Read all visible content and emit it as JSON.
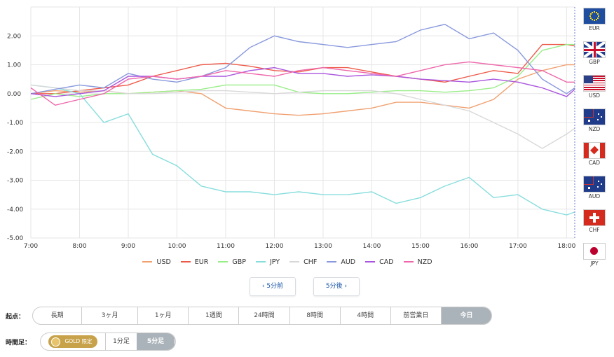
{
  "chart_data": {
    "type": "line",
    "x": [
      "7:00",
      "7:30",
      "8:00",
      "8:30",
      "9:00",
      "9:30",
      "10:00",
      "10:30",
      "11:00",
      "11:30",
      "12:00",
      "12:30",
      "13:00",
      "13:30",
      "14:00",
      "14:30",
      "15:00",
      "15:30",
      "16:00",
      "16:30",
      "17:00",
      "17:30",
      "18:00",
      "18:10"
    ],
    "x_ticks": [
      "7:00",
      "8:00",
      "9:00",
      "10:00",
      "11:00",
      "12:00",
      "13:00",
      "14:00",
      "15:00",
      "16:00",
      "17:00",
      "18:00"
    ],
    "y_ticks": [
      "2.00",
      "1.00",
      "0.00",
      "-1.00",
      "-2.00",
      "-3.00",
      "-4.00",
      "-5.00"
    ],
    "ylim": [
      -5,
      3
    ],
    "grid": true,
    "legend_position": "bottom",
    "series": [
      {
        "name": "USD",
        "color": "#f0a070",
        "values": [
          0,
          0.1,
          0.05,
          0.1,
          0,
          0.05,
          0.1,
          0,
          -0.5,
          -0.6,
          -0.7,
          -0.75,
          -0.7,
          -0.6,
          -0.5,
          -0.3,
          -0.3,
          -0.4,
          -0.5,
          -0.2,
          0.5,
          0.8,
          1.0,
          1.0
        ]
      },
      {
        "name": "EUR",
        "color": "#ee5a4a",
        "values": [
          0,
          0,
          0.1,
          0.2,
          0.3,
          0.6,
          0.8,
          1.0,
          1.05,
          0.95,
          0.8,
          0.75,
          0.9,
          0.9,
          0.75,
          0.6,
          0.5,
          0.4,
          0.6,
          0.8,
          0.7,
          1.7,
          1.7,
          1.65
        ]
      },
      {
        "name": "GBP",
        "color": "#99ee88",
        "values": [
          -0.2,
          0,
          -0.1,
          0,
          0,
          0.05,
          0.1,
          0.15,
          0.3,
          0.3,
          0.3,
          0.05,
          0,
          0,
          0.05,
          0.1,
          0.1,
          0.05,
          0.1,
          0.2,
          0.6,
          1.5,
          1.7,
          1.7
        ]
      },
      {
        "name": "JPY",
        "color": "#88dddd",
        "values": [
          0.3,
          0.2,
          0,
          -1.0,
          -0.7,
          -2.1,
          -2.5,
          -3.2,
          -3.4,
          -3.4,
          -3.5,
          -3.4,
          -3.5,
          -3.5,
          -3.4,
          -3.8,
          -3.6,
          -3.2,
          -2.9,
          -3.6,
          -3.5,
          -4.0,
          -4.2,
          -4.1
        ]
      },
      {
        "name": "CHF",
        "color": "#d8d8d8",
        "values": [
          0.3,
          0.2,
          0.1,
          0.1,
          0,
          0,
          0.05,
          0.1,
          0.1,
          0.05,
          0,
          0.05,
          0.1,
          0.1,
          0.1,
          0,
          -0.2,
          -0.4,
          -0.6,
          -1.0,
          -1.4,
          -1.9,
          -1.4,
          -1.2
        ]
      },
      {
        "name": "AUD",
        "color": "#8899dd",
        "values": [
          0,
          0.15,
          0.3,
          0.2,
          0.7,
          0.5,
          0.4,
          0.6,
          0.9,
          1.6,
          2.0,
          1.8,
          1.7,
          1.6,
          1.7,
          1.8,
          2.2,
          2.4,
          1.9,
          2.1,
          1.5,
          0.5,
          0,
          0.2
        ]
      },
      {
        "name": "CAD",
        "color": "#aa55dd",
        "values": [
          0,
          -0.1,
          0,
          0.1,
          0.6,
          0.6,
          0.5,
          0.6,
          0.6,
          0.8,
          0.9,
          0.7,
          0.7,
          0.6,
          0.65,
          0.6,
          0.5,
          0.45,
          0.4,
          0.5,
          0.4,
          0.2,
          -0.1,
          0.15
        ]
      },
      {
        "name": "NZD",
        "color": "#ee66aa",
        "values": [
          0.2,
          -0.4,
          -0.2,
          0,
          0.5,
          0.6,
          0.5,
          0.6,
          0.8,
          0.7,
          0.6,
          0.8,
          0.9,
          0.8,
          0.7,
          0.6,
          0.8,
          1.0,
          1.1,
          1.0,
          0.9,
          0.8,
          0.4,
          0.4
        ]
      }
    ]
  },
  "flags": [
    {
      "code": "EUR",
      "color": "#1f4da0"
    },
    {
      "code": "GBP",
      "color": "#1f3b8a"
    },
    {
      "code": "USD",
      "color": "#c8102e"
    },
    {
      "code": "NZD",
      "color": "#1f3b8a"
    },
    {
      "code": "CAD",
      "color": "#d52b1e"
    },
    {
      "code": "AUD",
      "color": "#1f3b8a"
    },
    {
      "code": "CHF",
      "color": "#d52b1e"
    },
    {
      "code": "JPY",
      "color": "#bc002d"
    }
  ],
  "nav": {
    "prev": "‹ 5分前",
    "next": "5分後 ›"
  },
  "controls": {
    "start_label": "起点：",
    "start_options": [
      "長期",
      "3ヶ月",
      "1ヶ月",
      "1週間",
      "24時間",
      "8時間",
      "4時間",
      "前営業日",
      "今日"
    ],
    "start_selected": "今日",
    "timeframe_label": "時間足：",
    "gold_badge": "GOLD 限定",
    "timeframe_options": [
      "1分足",
      "5分足"
    ],
    "timeframe_selected": "5分足"
  }
}
